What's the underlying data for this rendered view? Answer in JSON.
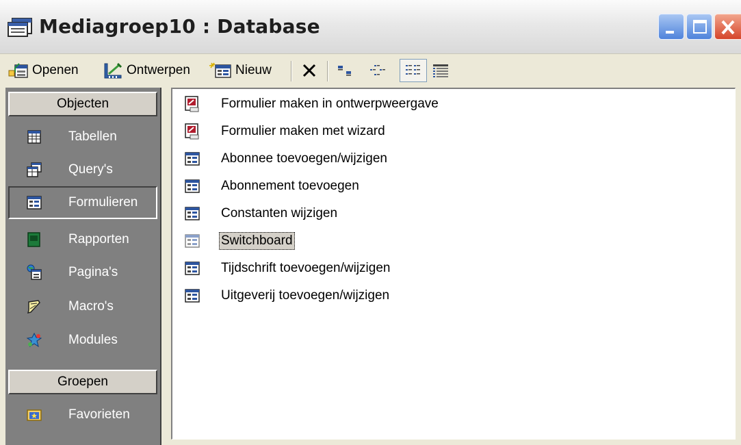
{
  "window": {
    "title": "Mediagroep10 : Database",
    "controls": [
      "minimize",
      "maximize",
      "close"
    ]
  },
  "toolbar": {
    "open_label": "Openen",
    "design_label": "Ontwerpen",
    "new_label": "Nieuw",
    "buttons": [
      {
        "name": "delete-icon"
      },
      {
        "name": "large-icons-view-icon"
      },
      {
        "name": "small-icons-view-icon"
      },
      {
        "name": "list-view-icon",
        "pressed": true
      },
      {
        "name": "details-view-icon"
      }
    ]
  },
  "sidebar": {
    "objects_header": "Objecten",
    "groups_header": "Groepen",
    "items": [
      {
        "label": "Tabellen",
        "icon": "table-icon"
      },
      {
        "label": "Query's",
        "icon": "query-icon"
      },
      {
        "label": "Formulieren",
        "icon": "form-icon",
        "selected": true
      },
      {
        "label": "Rapporten",
        "icon": "report-icon"
      },
      {
        "label": "Pagina's",
        "icon": "page-icon"
      },
      {
        "label": "Macro's",
        "icon": "macro-icon"
      },
      {
        "label": "Modules",
        "icon": "module-icon"
      }
    ],
    "groups": [
      {
        "label": "Favorieten",
        "icon": "favorites-icon"
      }
    ]
  },
  "list": {
    "items": [
      {
        "label": "Formulier maken in ontwerpweergave",
        "icon": "wizard-shortcut-icon"
      },
      {
        "label": "Formulier maken met wizard",
        "icon": "wizard-shortcut-icon"
      },
      {
        "label": "Abonnee toevoegen/wijzigen",
        "icon": "form-icon"
      },
      {
        "label": "Abonnement toevoegen",
        "icon": "form-icon"
      },
      {
        "label": "Constanten wijzigen",
        "icon": "form-icon"
      },
      {
        "label": "Switchboard",
        "icon": "form-icon",
        "focused": true
      },
      {
        "label": "Tijdschrift toevoegen/wijzigen",
        "icon": "form-icon"
      },
      {
        "label": "Uitgeverij toevoegen/wijzigen",
        "icon": "form-icon"
      }
    ]
  }
}
